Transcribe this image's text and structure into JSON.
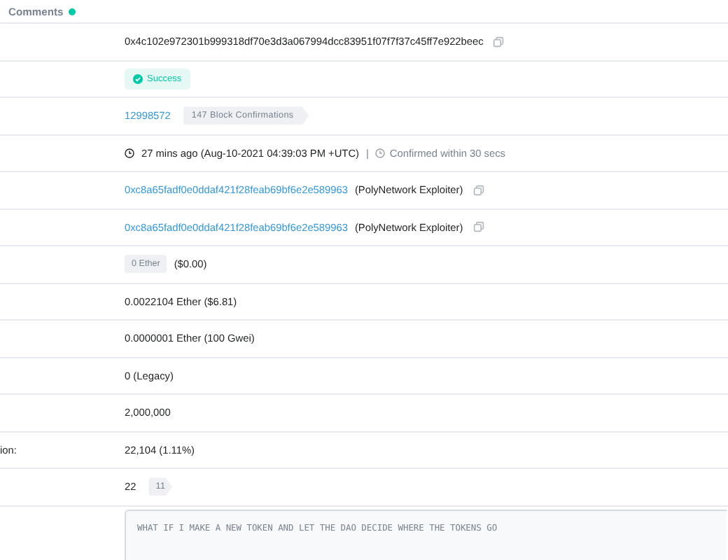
{
  "header": {
    "title": "Comments"
  },
  "rows": [
    {
      "kind": "hash",
      "text": "0x4c102e972301b999318df70e3d3a067994dcc83951f07f7f37c45ff7e922beec",
      "copy": true
    },
    {
      "kind": "status",
      "badge": "Success"
    },
    {
      "kind": "block",
      "link": "12998572",
      "badge": "147 Block Confirmations"
    },
    {
      "kind": "time",
      "text": "27 mins ago (Aug-10-2021 04:39:03 PM +UTC)",
      "separator": "|",
      "note": "Confirmed within 30 secs"
    },
    {
      "kind": "address",
      "link": "0xc8a65fadf0e0ddaf421f28feab69bf6e2e589963",
      "text": "(PolyNetwork Exploiter)",
      "copy": true
    },
    {
      "kind": "address",
      "link": "0xc8a65fadf0e0ddaf421f28feab69bf6e2e589963",
      "text": "(PolyNetwork Exploiter)",
      "copy": true
    },
    {
      "kind": "ether",
      "badge": "0 Ether",
      "text": "($0.00)"
    },
    {
      "kind": "text",
      "text": "0.0022104 Ether ($6.81)"
    },
    {
      "kind": "text",
      "text": "0.0000001 Ether (100 Gwei)"
    },
    {
      "kind": "text",
      "text": "0 (Legacy)"
    },
    {
      "kind": "text",
      "text": "2,000,000"
    },
    {
      "kind": "text",
      "label": "ion:",
      "text": "22,104 (1.11%)"
    },
    {
      "kind": "nonce",
      "text": "22",
      "badge": "11"
    },
    {
      "kind": "input",
      "text": "WHAT IF I MAKE A NEW TOKEN AND LET THE DAO DECIDE WHERE THE TOKENS GO"
    }
  ]
}
